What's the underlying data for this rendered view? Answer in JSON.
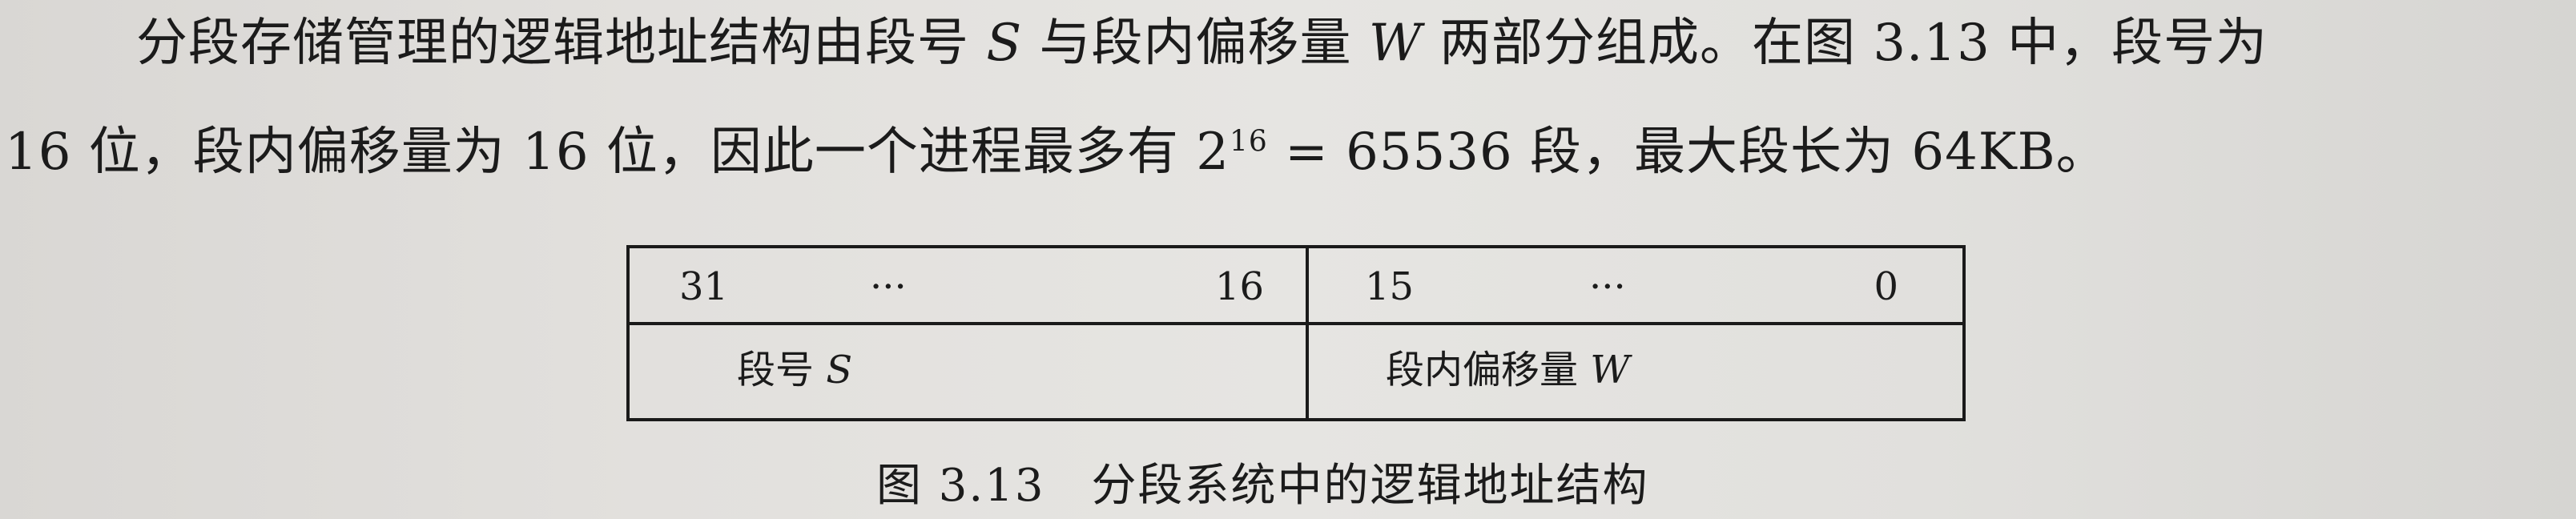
{
  "paragraph": {
    "line1": {
      "part1": "分段存储管理的逻辑地址结构由段号",
      "s_symbol": "S",
      "part2": "与段内偏移量",
      "w_symbol": "W",
      "part3": "两部分组成。在图 3.13 中，段号为"
    },
    "line2": {
      "part1": "16 位，段内偏移量为 16 位，因此一个进程最多有 2",
      "exponent": "16",
      "part2": " = 65536 段，最大段长为 64KB。"
    }
  },
  "figure": {
    "bits_left": {
      "high": "31",
      "dots": "···",
      "low": "16"
    },
    "bits_right": {
      "high": "15",
      "dots": "···",
      "low": "0"
    },
    "segment_number_label": "段号",
    "segment_number_symbol": "S",
    "offset_label": "段内偏移量",
    "offset_symbol": "W",
    "caption": "图 3.13　分段系统中的逻辑地址结构"
  }
}
